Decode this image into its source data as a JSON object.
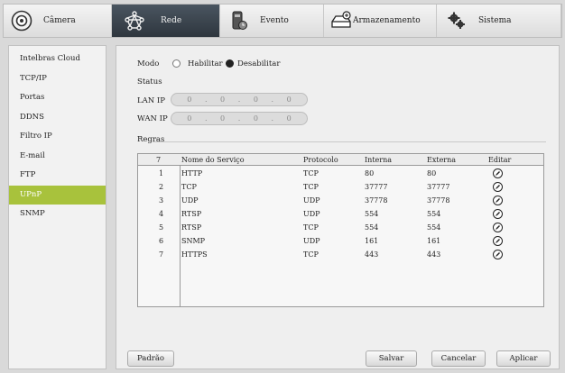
{
  "topnav": [
    {
      "label": "Câmera",
      "icon": "camera-icon"
    },
    {
      "label": "Rede",
      "icon": "network-icon"
    },
    {
      "label": "Evento",
      "icon": "event-icon"
    },
    {
      "label": "Armazenamento",
      "icon": "storage-icon"
    },
    {
      "label": "Sistema",
      "icon": "gears-icon"
    }
  ],
  "active_tab": "Rede",
  "sidebar": {
    "items": [
      {
        "label": "Intelbras Cloud"
      },
      {
        "label": "TCP/IP"
      },
      {
        "label": "Portas"
      },
      {
        "label": "DDNS"
      },
      {
        "label": "Filtro IP"
      },
      {
        "label": "E-mail"
      },
      {
        "label": "FTP"
      },
      {
        "label": "UPnP"
      },
      {
        "label": "SNMP"
      }
    ],
    "active": "UPnP"
  },
  "form": {
    "mode_label": "Modo",
    "enable_label": "Habilitar",
    "disable_label": "Desabilitar",
    "selected_mode": "Desabilitar",
    "status_label": "Status",
    "lan_label": "LAN IP",
    "lan_ip": [
      "0",
      "0",
      "0",
      "0"
    ],
    "wan_label": "WAN IP",
    "wan_ip": [
      "0",
      "0",
      "0",
      "0"
    ],
    "rules_label": "Regras"
  },
  "table": {
    "headers": {
      "count": "7",
      "service": "Nome do Serviço",
      "protocol": "Protocolo",
      "internal": "Interna",
      "external": "Externa",
      "edit": "Editar"
    },
    "rows": [
      {
        "n": "1",
        "service": "HTTP",
        "protocol": "TCP",
        "internal": "80",
        "external": "80"
      },
      {
        "n": "2",
        "service": "TCP",
        "protocol": "TCP",
        "internal": "37777",
        "external": "37777"
      },
      {
        "n": "3",
        "service": "UDP",
        "protocol": "UDP",
        "internal": "37778",
        "external": "37778"
      },
      {
        "n": "4",
        "service": "RTSP",
        "protocol": "UDP",
        "internal": "554",
        "external": "554"
      },
      {
        "n": "5",
        "service": "RTSP",
        "protocol": "TCP",
        "internal": "554",
        "external": "554"
      },
      {
        "n": "6",
        "service": "SNMP",
        "protocol": "UDP",
        "internal": "161",
        "external": "161"
      },
      {
        "n": "7",
        "service": "HTTPS",
        "protocol": "TCP",
        "internal": "443",
        "external": "443"
      }
    ]
  },
  "buttons": {
    "default": "Padrão",
    "save": "Salvar",
    "cancel": "Cancelar",
    "apply": "Aplicar"
  },
  "colors": {
    "accent": "#a8c23c",
    "active_tab": "#3a434b"
  }
}
